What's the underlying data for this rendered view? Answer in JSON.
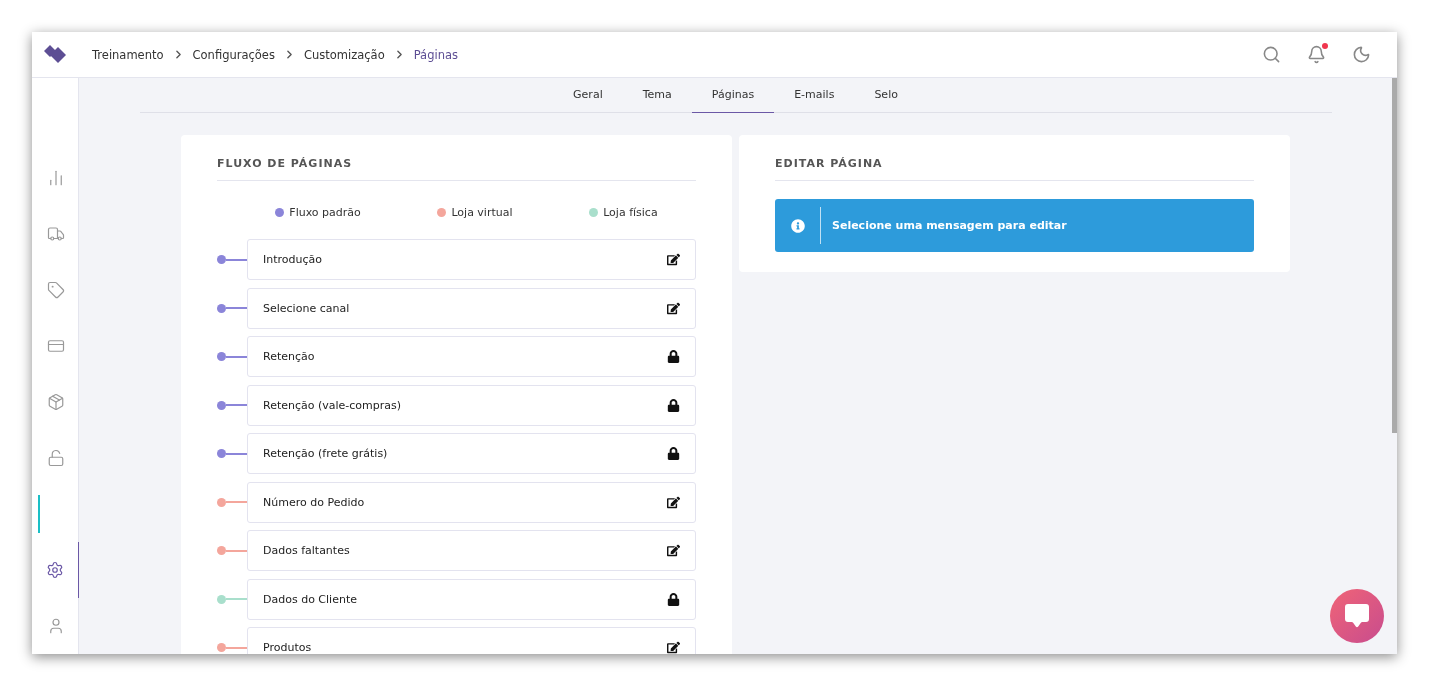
{
  "breadcrumb": [
    {
      "label": "Treinamento",
      "current": false
    },
    {
      "label": "Configurações",
      "current": false
    },
    {
      "label": "Customização",
      "current": false
    },
    {
      "label": "Páginas",
      "current": true
    }
  ],
  "header": {
    "notification_badge": true
  },
  "sidebar": {
    "items": [
      {
        "kind": "chart",
        "selected": false
      },
      {
        "kind": "truck",
        "selected": false
      },
      {
        "kind": "tag",
        "selected": false
      },
      {
        "kind": "card",
        "selected": false
      },
      {
        "kind": "box",
        "selected": false
      },
      {
        "kind": "unlock",
        "selected": false
      },
      {
        "kind": "marker",
        "selected": false
      },
      {
        "kind": "settings",
        "selected": true
      },
      {
        "kind": "user",
        "selected": false
      }
    ]
  },
  "tabs": [
    {
      "label": "Geral",
      "selected": false
    },
    {
      "label": "Tema",
      "selected": false
    },
    {
      "label": "Páginas",
      "selected": true
    },
    {
      "label": "E-mails",
      "selected": false
    },
    {
      "label": "Selo",
      "selected": false
    }
  ],
  "flow_card": {
    "title": "FLUXO DE PÁGINAS",
    "legend": [
      {
        "label": "Fluxo padrão",
        "color": "#8b85d9"
      },
      {
        "label": "Loja virtual",
        "color": "#f4a69c"
      },
      {
        "label": "Loja física",
        "color": "#a9dfcc"
      }
    ],
    "pages": [
      {
        "label": "Introdução",
        "kind": "edit",
        "color": "#8b85d9"
      },
      {
        "label": "Selecione canal",
        "kind": "edit",
        "color": "#8b85d9"
      },
      {
        "label": "Retenção",
        "kind": "locked",
        "color": "#8b85d9"
      },
      {
        "label": "Retenção (vale-compras)",
        "kind": "locked",
        "color": "#8b85d9"
      },
      {
        "label": "Retenção (frete grátis)",
        "kind": "locked",
        "color": "#8b85d9"
      },
      {
        "label": "Número do Pedido",
        "kind": "edit",
        "color": "#f4a69c"
      },
      {
        "label": "Dados faltantes",
        "kind": "edit",
        "color": "#f4a69c"
      },
      {
        "label": "Dados do Cliente",
        "kind": "locked",
        "color": "#a9dfcc"
      },
      {
        "label": "Produtos",
        "kind": "edit",
        "color": "#f4a69c"
      }
    ]
  },
  "edit_card": {
    "title": "EDITAR PÁGINA",
    "alert": "Selecione uma mensagem para editar"
  }
}
